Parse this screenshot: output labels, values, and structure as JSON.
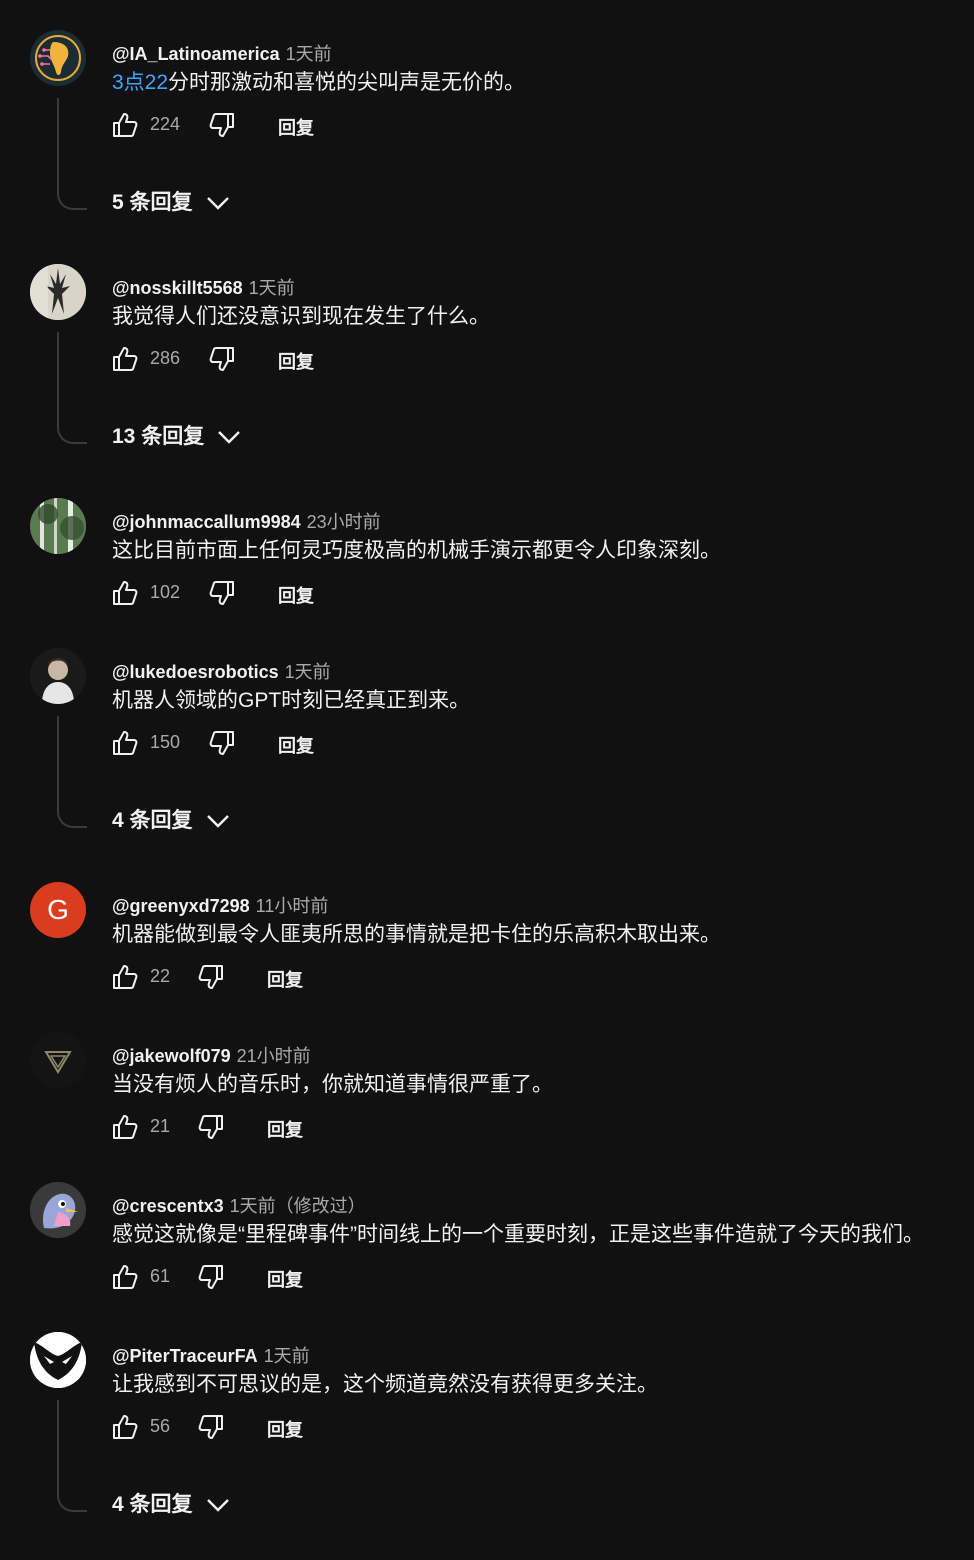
{
  "comments": [
    {
      "author": "@IA_Latinoamerica",
      "time": "1天前",
      "timestamp": "3点22",
      "text": "分时那激动和喜悦的尖叫声是无价的。",
      "likes": "224",
      "reply_label": "回复",
      "replies_label": "5 条回复"
    },
    {
      "author": "@nosskillt5568",
      "time": "1天前",
      "text": "我觉得人们还没意识到现在发生了什么。",
      "likes": "286",
      "reply_label": "回复",
      "replies_label": "13 条回复"
    },
    {
      "author": "@johnmaccallum9984",
      "time": "23小时前",
      "text": "这比目前市面上任何灵巧度极高的机械手演示都更令人印象深刻。",
      "likes": "102",
      "reply_label": "回复"
    },
    {
      "author": "@lukedoesrobotics",
      "time": "1天前",
      "text": "机器人领域的GPT时刻已经真正到来。",
      "likes": "150",
      "reply_label": "回复",
      "replies_label": "4 条回复"
    },
    {
      "author": "@greenyxd7298",
      "time": "11小时前",
      "avatar_letter": "G",
      "text": "机器能做到最令人匪夷所思的事情就是把卡住的乐高积木取出来。",
      "likes": "22",
      "reply_label": "回复"
    },
    {
      "author": "@jakewolf079",
      "time": "21小时前",
      "text": "当没有烦人的音乐时，你就知道事情很严重了。",
      "likes": "21",
      "reply_label": "回复"
    },
    {
      "author": "@crescentx3",
      "time": "1天前（修改过）",
      "text": "感觉这就像是“里程碑事件”时间线上的一个重要时刻，正是这些事件造就了今天的我们。",
      "likes": "61",
      "reply_label": "回复"
    },
    {
      "author": "@PiterTraceurFA",
      "time": "1天前",
      "text": "让我感到不可思议的是，这个频道竟然没有获得更多关注。",
      "likes": "56",
      "reply_label": "回复",
      "replies_label": "4 条回复"
    }
  ],
  "colors": {
    "background": "#111111",
    "text": "#f1f1f1",
    "secondary": "#aaaaaa",
    "link": "#3ea6ff",
    "avatar_g": "#d93c1e"
  }
}
